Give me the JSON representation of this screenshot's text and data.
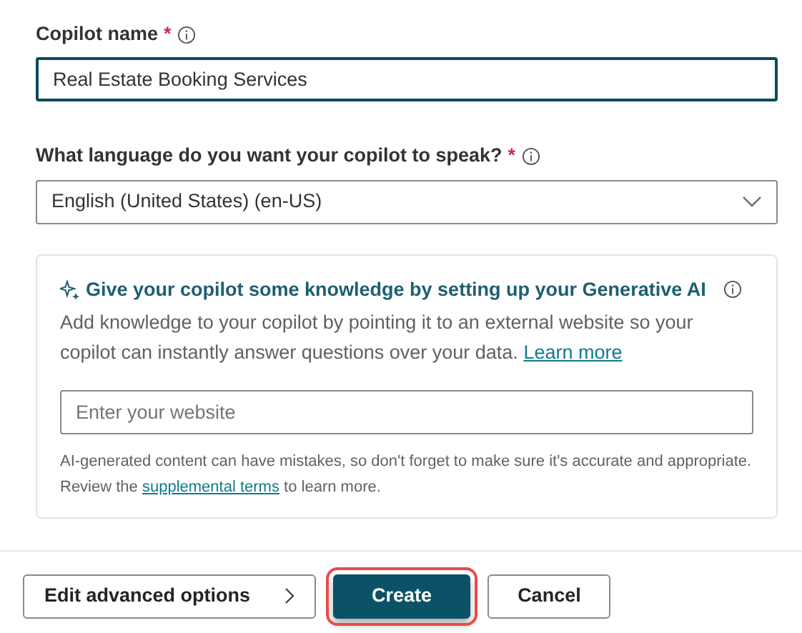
{
  "name_field": {
    "label": "Copilot name",
    "required_mark": "*",
    "value": "Real Estate Booking Services",
    "focused": true
  },
  "language_field": {
    "label": "What language do you want your copilot to speak?",
    "required_mark": "*",
    "value": "English (United States) (en-US)"
  },
  "knowledge_card": {
    "title": "Give your copilot some knowledge by setting up your Generative AI",
    "description": "Add knowledge to your copilot by pointing it to an external website so your copilot can instantly answer questions over your data.",
    "description_link": "Learn more",
    "website_field": {
      "placeholder": "Enter your website"
    },
    "disclaimer_before": "AI-generated content can have mistakes, so don't forget to make sure it's accurate and appropriate. Review the",
    "disclaimer_link": "supplemental terms",
    "disclaimer_after": "to learn more."
  },
  "buttons": [
    {
      "label": "Edit advanced options",
      "kind": "next",
      "highlighted": false
    },
    {
      "label": "Create",
      "kind": "primary",
      "highlighted": true
    },
    {
      "label": "Cancel",
      "kind": "secondary",
      "highlighted": false
    }
  ]
}
